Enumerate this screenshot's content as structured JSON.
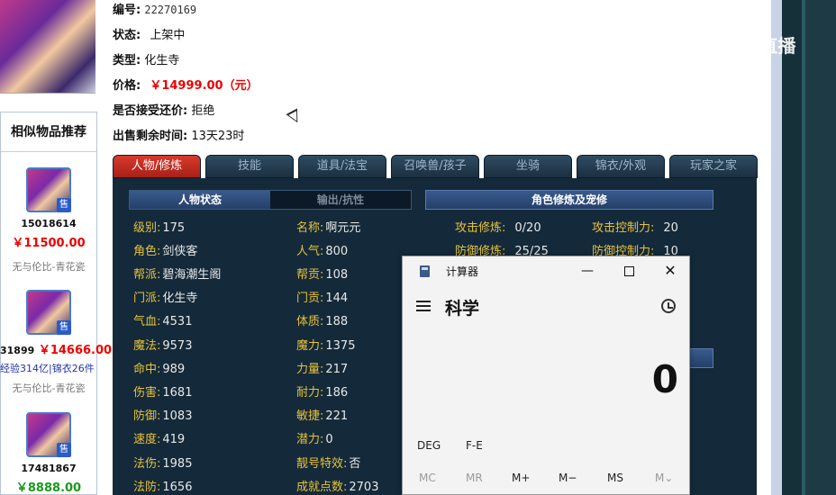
{
  "item": {
    "id_label": "编号:",
    "id_value": "22270169",
    "status_label": "状态:",
    "status_value": "上架中",
    "type_label": "类型:",
    "type_value": "化生寺",
    "price_label": "价格:",
    "price_value": "￥14999.00（元）",
    "bargain_label": "是否接受还价:",
    "bargain_value": "拒绝",
    "time_label": "出售剩余时间:",
    "time_value": "13天23时"
  },
  "similar": {
    "title": "相似物品推荐",
    "items": [
      {
        "id": "15018614",
        "price": "￥11500.00",
        "server": "无与伦比-青花瓷",
        "badge": "售"
      },
      {
        "id": "31899",
        "price": "￥14666.00",
        "extra_a": "经验314亿",
        "extra_sep": "|",
        "extra_b": "锦衣26件",
        "server": "无与伦比-青花瓷",
        "badge": "售"
      },
      {
        "id": "17481867",
        "price": "￥8888.00",
        "badge": "售"
      }
    ]
  },
  "tabs": [
    "人物/修炼",
    "技能",
    "道具/法宝",
    "召唤兽/孩子",
    "坐骑",
    "锦衣/外观",
    "玩家之家"
  ],
  "subtabs": {
    "status": "人物状态",
    "output": "输出/抗性",
    "cultivation": "角色修炼及宠修"
  },
  "stats_col1": [
    {
      "k": "级别:",
      "v": "175"
    },
    {
      "k": "角色:",
      "v": "剑侠客"
    },
    {
      "k": "帮派:",
      "v": "碧海潮生阁"
    },
    {
      "k": "门派:",
      "v": "化生寺"
    },
    {
      "k": "气血:",
      "v": "4531"
    },
    {
      "k": "魔法:",
      "v": "9573"
    },
    {
      "k": "命中:",
      "v": "989"
    },
    {
      "k": "伤害:",
      "v": "1681"
    },
    {
      "k": "防御:",
      "v": "1083"
    },
    {
      "k": "速度:",
      "v": "419"
    },
    {
      "k": "法伤:",
      "v": "1985"
    },
    {
      "k": "法防:",
      "v": "1656"
    }
  ],
  "stats_col2": [
    {
      "k": "名称:",
      "v": "啊元元"
    },
    {
      "k": "人气:",
      "v": "800"
    },
    {
      "k": "帮贡:",
      "v": "108"
    },
    {
      "k": "门贡:",
      "v": "144"
    },
    {
      "k": "体质:",
      "v": "188"
    },
    {
      "k": "魔力:",
      "v": "1375"
    },
    {
      "k": "力量:",
      "v": "217"
    },
    {
      "k": "耐力:",
      "v": "186"
    },
    {
      "k": "敏捷:",
      "v": "221"
    },
    {
      "k": "潜力:",
      "v": "0"
    },
    {
      "k": "靓号特效:",
      "v": "否"
    },
    {
      "k": "成就点数:",
      "v": "2703"
    }
  ],
  "cultivation": [
    {
      "k": "攻击修炼:",
      "v": "0/20"
    },
    {
      "k": "攻击控制力:",
      "v": "20"
    },
    {
      "k": "防御修炼:",
      "v": "25/25"
    },
    {
      "k": "防御控制力:",
      "v": "10"
    }
  ],
  "calculator": {
    "title": "计算器",
    "min": "—",
    "close": "✕",
    "mode": "科学",
    "display": "0",
    "deg": "DEG",
    "fe": "F-E",
    "mc": "MC",
    "mr": "MR",
    "mplus": "M+",
    "mminus": "M−",
    "ms": "MS",
    "mdrop": "M⌄"
  },
  "watermark": "CC直播"
}
